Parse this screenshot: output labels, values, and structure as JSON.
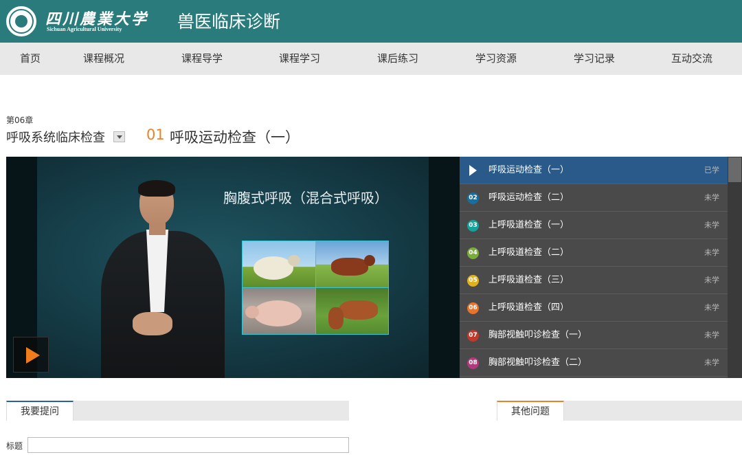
{
  "header": {
    "university_cn": "四川農業大学",
    "university_en": "Sichuan Agricultural University",
    "course_title": "兽医临床诊断",
    "brand_color": "#2a7b7b"
  },
  "nav": {
    "items": [
      {
        "label": "首页"
      },
      {
        "label": "课程概况"
      },
      {
        "label": "课程导学"
      },
      {
        "label": "课程学习"
      },
      {
        "label": "课后练习"
      },
      {
        "label": "学习资源"
      },
      {
        "label": "学习记录"
      },
      {
        "label": "互动交流"
      }
    ]
  },
  "chapter": {
    "label": "第06章",
    "name": "呼吸系统临床检查",
    "lesson_number": "01",
    "lesson_title": "呼吸运动检查（一）"
  },
  "video": {
    "slide_caption": "胸腹式呼吸（混合式呼吸）",
    "play_icon": "play-icon"
  },
  "playlist": {
    "items": [
      {
        "num": "",
        "title": "呼吸运动检查（一）",
        "status": "已学",
        "badge_color": "",
        "active": true
      },
      {
        "num": "02",
        "title": "呼吸运动检查（二）",
        "status": "未学",
        "badge_color": "#1b6d9c"
      },
      {
        "num": "03",
        "title": "上呼吸道检查（一）",
        "status": "未学",
        "badge_color": "#14a39a"
      },
      {
        "num": "04",
        "title": "上呼吸道检查（二）",
        "status": "未学",
        "badge_color": "#7aab3c"
      },
      {
        "num": "05",
        "title": "上呼吸道检查（三）",
        "status": "未学",
        "badge_color": "#e0b01e"
      },
      {
        "num": "06",
        "title": "上呼吸道检查（四）",
        "status": "未学",
        "badge_color": "#e8732a"
      },
      {
        "num": "07",
        "title": "胸部视触叩诊检查（一）",
        "status": "未学",
        "badge_color": "#c0392b"
      },
      {
        "num": "08",
        "title": "胸部视触叩诊检查（二）",
        "status": "未学",
        "badge_color": "#b03a7a"
      }
    ]
  },
  "questions": {
    "ask_tab": "我要提问",
    "other_tab": "其他问题",
    "title_label": "标题",
    "title_value": ""
  }
}
